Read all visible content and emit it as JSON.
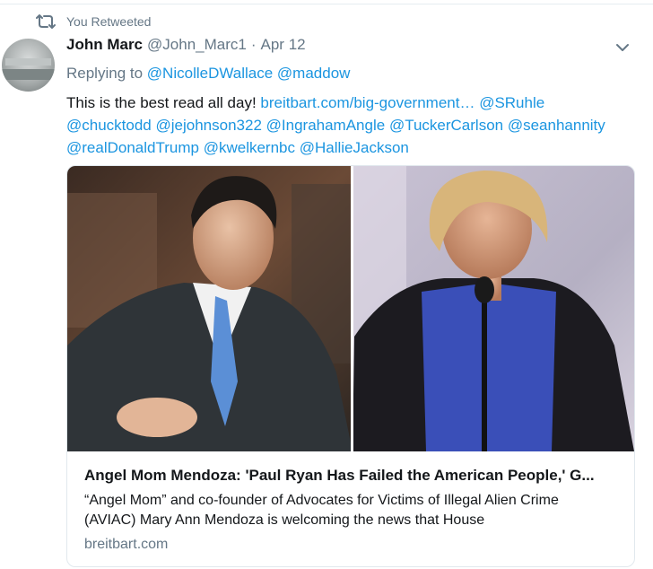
{
  "retweet": {
    "label": "You Retweeted",
    "icon": "retweet-icon"
  },
  "author": {
    "name": "John Marc",
    "handle": "@John_Marc1",
    "separator": "·",
    "date": "Apr 12"
  },
  "reply": {
    "prefix": "Replying to",
    "mentions": [
      "@NicolleDWallace",
      "@maddow"
    ]
  },
  "tweet": {
    "text_plain": "This is the best read all day!",
    "link": "breitbart.com/big-government…",
    "mentions_line1_end": "@SRuhle",
    "mentions_line2": [
      "@chucktodd",
      "@jejohnson322",
      "@IngrahamAngle",
      "@TuckerCarlson",
      "@seanhannity"
    ],
    "mentions_line3": [
      "@realDonaldTrump",
      "@kwelkernbc",
      "@HallieJackson"
    ]
  },
  "card": {
    "title": "Angel Mom Mendoza: 'Paul Ryan Has Failed the American People,' G...",
    "description": "“Angel Mom” and co-founder of Advocates for Victims of Illegal Alien Crime (AVIAC) Mary Ann Mendoza is welcoming the news that House",
    "domain": "breitbart.com"
  },
  "colors": {
    "link": "#1b95e0",
    "muted": "#657786",
    "text": "#14171a",
    "border": "#e1e8ed"
  }
}
